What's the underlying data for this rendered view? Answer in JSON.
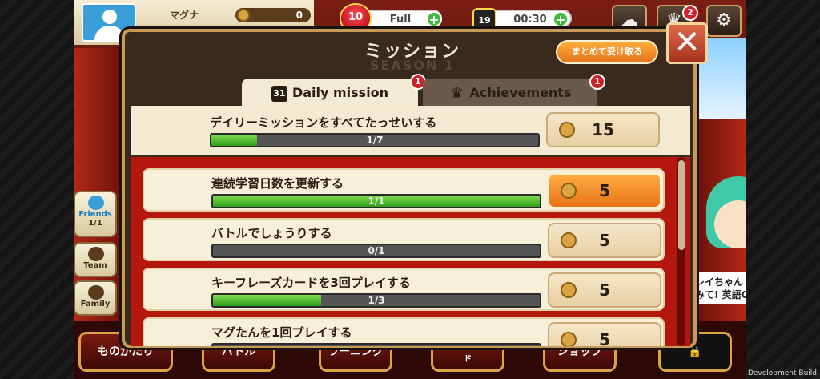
{
  "hud": {
    "player_name": "マグナ",
    "coins": "0",
    "hearts": "10",
    "stamina": "Full",
    "timer_count": "19",
    "timer": "00:30",
    "notif_badge": "2"
  },
  "side": {
    "friends_label": "Friends",
    "friends_count": "1/1",
    "team_label": "Team",
    "family_label": "Family"
  },
  "bottom_nav": [
    "ものがたり",
    "バトル",
    "ラーニング",
    "レジェンズワールド",
    "ショップ"
  ],
  "promo": {
    "girl_text": "レイちゃん かけてみて! 英語OK"
  },
  "dialog": {
    "title": "ミッション",
    "subtitle": "SEASON 1",
    "collect_all": "まとめて受け取る",
    "close": "✕",
    "tabs": [
      {
        "label": "Daily mission",
        "badge": "1"
      },
      {
        "label": "Achievements",
        "badge": "1"
      }
    ],
    "summary": {
      "label": "デイリーミッションをすべてたっせいする",
      "progress_text": "1/7",
      "progress": 0.14,
      "reward": "15"
    },
    "missions": [
      {
        "label": "連続学習日数を更新する",
        "progress_text": "1/1",
        "progress": 1.0,
        "reward": "5",
        "claimable": true
      },
      {
        "label": "バトルでしょうりする",
        "progress_text": "0/1",
        "progress": 0.0,
        "reward": "5",
        "claimable": false
      },
      {
        "label": "キーフレーズカードを3回プレイする",
        "progress_text": "1/3",
        "progress": 0.33,
        "reward": "5",
        "claimable": false
      },
      {
        "label": "マグたんを1回プレイする",
        "progress_text": "",
        "progress": 0.0,
        "reward": "5",
        "claimable": false
      }
    ]
  },
  "dev_label": "Development Build"
}
